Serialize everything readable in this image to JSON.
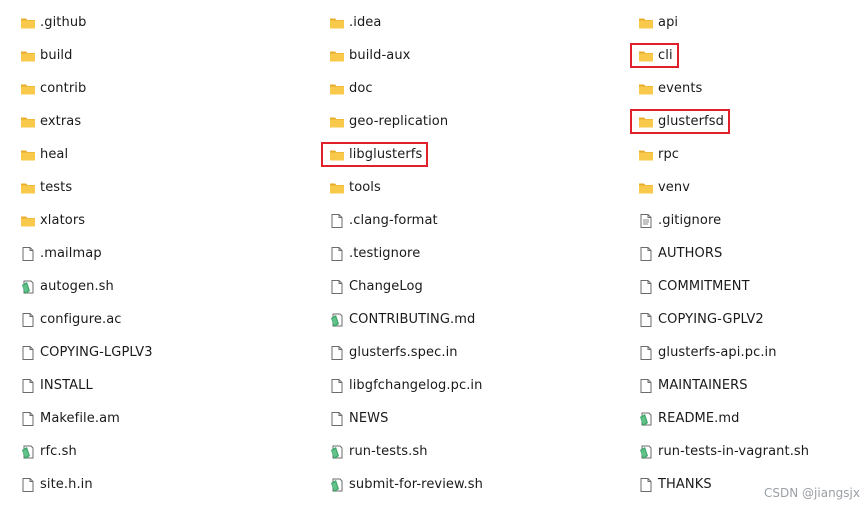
{
  "columns": [
    {
      "items": [
        {
          "name": ".github",
          "type": "folder"
        },
        {
          "name": "build",
          "type": "folder"
        },
        {
          "name": "contrib",
          "type": "folder"
        },
        {
          "name": "extras",
          "type": "folder"
        },
        {
          "name": "heal",
          "type": "folder"
        },
        {
          "name": "tests",
          "type": "folder"
        },
        {
          "name": "xlators",
          "type": "folder"
        },
        {
          "name": ".mailmap",
          "type": "file"
        },
        {
          "name": "autogen.sh",
          "type": "script"
        },
        {
          "name": "configure.ac",
          "type": "file"
        },
        {
          "name": "COPYING-LGPLV3",
          "type": "file"
        },
        {
          "name": "INSTALL",
          "type": "file"
        },
        {
          "name": "Makefile.am",
          "type": "file"
        },
        {
          "name": "rfc.sh",
          "type": "script"
        },
        {
          "name": "site.h.in",
          "type": "file"
        }
      ]
    },
    {
      "items": [
        {
          "name": ".idea",
          "type": "folder"
        },
        {
          "name": "build-aux",
          "type": "folder"
        },
        {
          "name": "doc",
          "type": "folder"
        },
        {
          "name": "geo-replication",
          "type": "folder"
        },
        {
          "name": "libglusterfs",
          "type": "folder",
          "highlighted": true
        },
        {
          "name": "tools",
          "type": "folder"
        },
        {
          "name": ".clang-format",
          "type": "file"
        },
        {
          "name": ".testignore",
          "type": "file"
        },
        {
          "name": "ChangeLog",
          "type": "file"
        },
        {
          "name": "CONTRIBUTING.md",
          "type": "script"
        },
        {
          "name": "glusterfs.spec.in",
          "type": "file"
        },
        {
          "name": "libgfchangelog.pc.in",
          "type": "file"
        },
        {
          "name": "NEWS",
          "type": "file"
        },
        {
          "name": "run-tests.sh",
          "type": "script"
        },
        {
          "name": "submit-for-review.sh",
          "type": "script"
        }
      ]
    },
    {
      "items": [
        {
          "name": "api",
          "type": "folder"
        },
        {
          "name": "cli",
          "type": "folder",
          "highlighted": true
        },
        {
          "name": "events",
          "type": "folder"
        },
        {
          "name": "glusterfsd",
          "type": "folder",
          "highlighted": true
        },
        {
          "name": "rpc",
          "type": "folder"
        },
        {
          "name": "venv",
          "type": "folder"
        },
        {
          "name": ".gitignore",
          "type": "textfile"
        },
        {
          "name": "AUTHORS",
          "type": "file"
        },
        {
          "name": "COMMITMENT",
          "type": "file"
        },
        {
          "name": "COPYING-GPLV2",
          "type": "file"
        },
        {
          "name": "glusterfs-api.pc.in",
          "type": "file"
        },
        {
          "name": "MAINTAINERS",
          "type": "file"
        },
        {
          "name": "README.md",
          "type": "script"
        },
        {
          "name": "run-tests-in-vagrant.sh",
          "type": "script"
        },
        {
          "name": "THANKS",
          "type": "file"
        }
      ]
    }
  ],
  "watermark": "CSDN @jiangsjx",
  "colors": {
    "folder_body": "#f8c94a",
    "folder_tab": "#e8ad2c",
    "highlight": "#e0202a",
    "script_green": "#3aa86a"
  }
}
